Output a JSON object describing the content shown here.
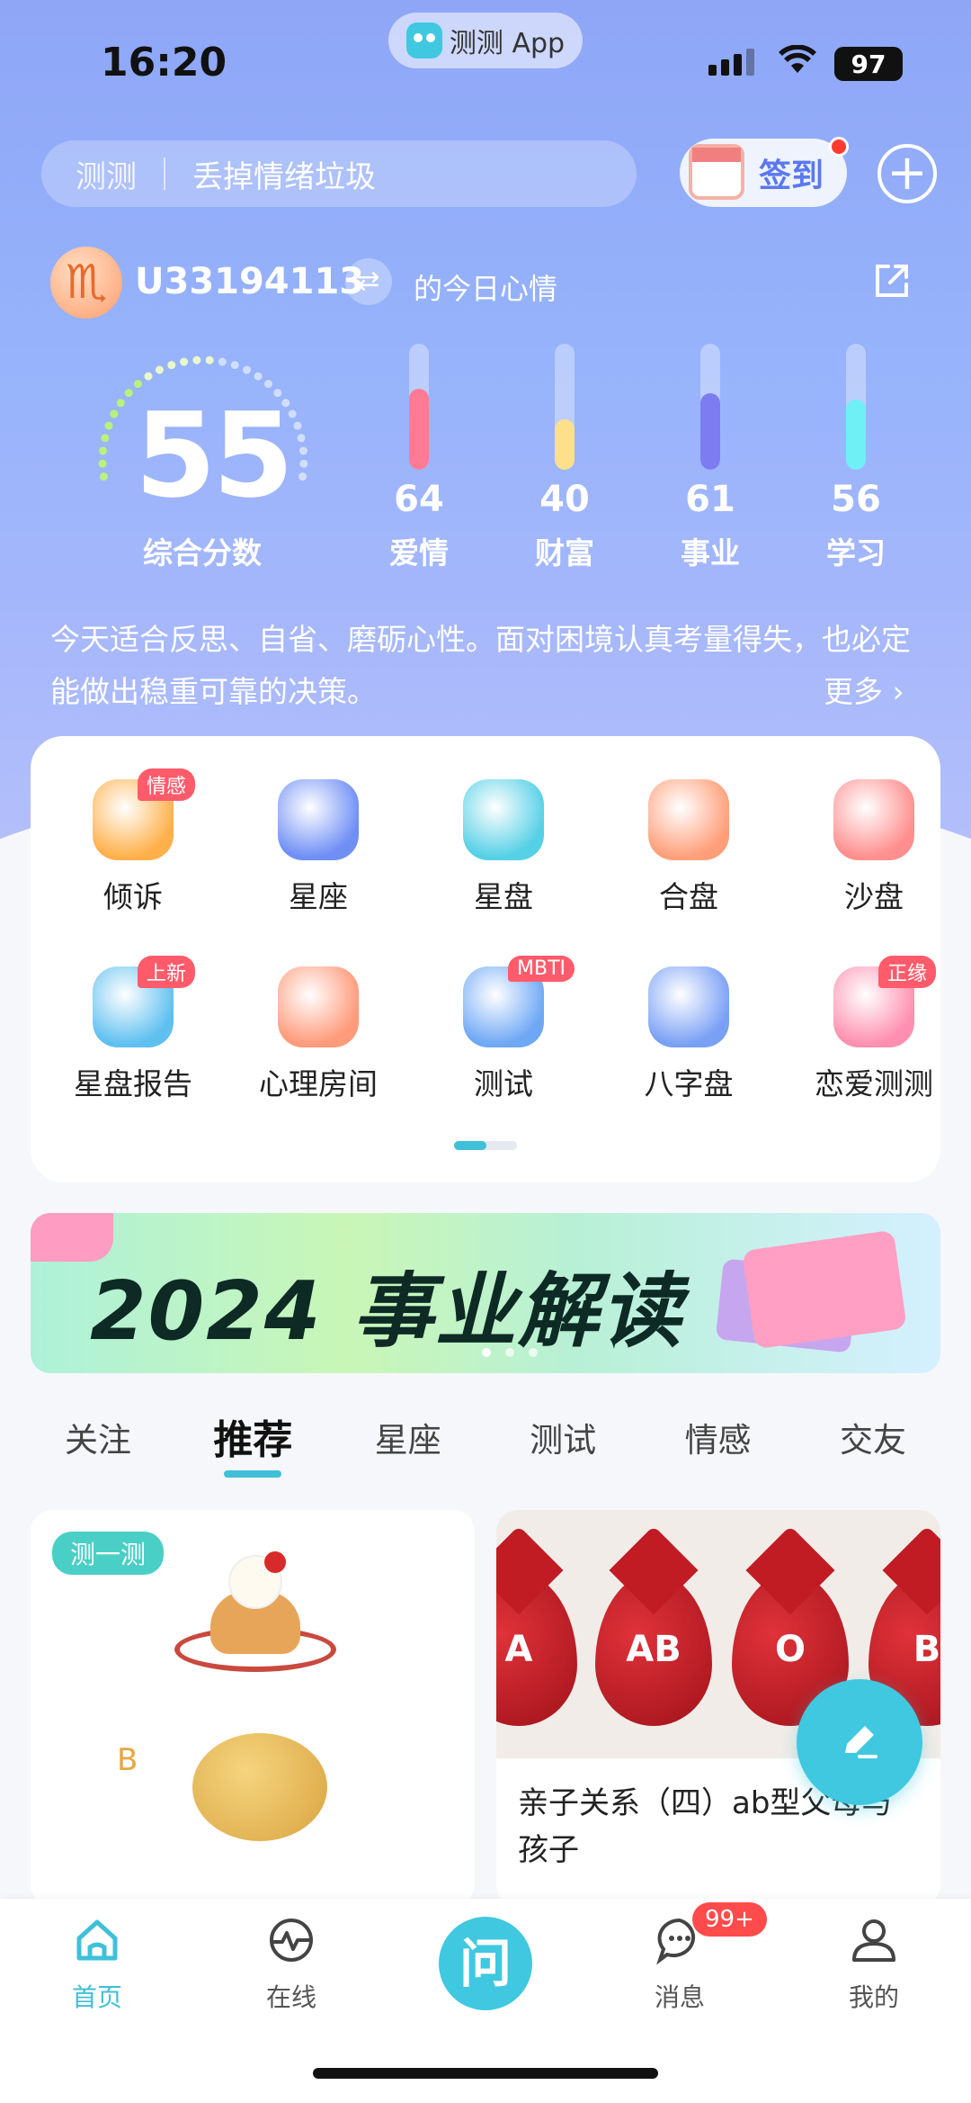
{
  "status": {
    "time": "16:20",
    "app_name": "测测 App",
    "battery": "97"
  },
  "search": {
    "brand": "测测",
    "placeholder": "丢掉情绪垃圾"
  },
  "signin": {
    "label": "签到"
  },
  "user": {
    "id": "U33194113",
    "today_label": "的今日心情",
    "sign_glyph": "♏"
  },
  "score": {
    "value": "55",
    "label": "综合分数",
    "value_numeric": 55
  },
  "metrics": [
    {
      "value": "64",
      "label": "爱情",
      "color": "#ff7a95",
      "level": 64
    },
    {
      "value": "40",
      "label": "财富",
      "color": "#ffe08a",
      "level": 40
    },
    {
      "value": "61",
      "label": "事业",
      "color": "#7d7cf1",
      "level": 61
    },
    {
      "value": "56",
      "label": "学习",
      "color": "#6ff0f5",
      "level": 56
    }
  ],
  "advice": {
    "text": "今天适合反思、自省、磨砺心性。面对困境认真考量得失，也必定能做出稳重可靠的决策。",
    "more": "更多"
  },
  "grid": [
    {
      "label": "倾诉",
      "badge": "情感",
      "icon": "chat-bubble-icon",
      "color": "#ffb04a"
    },
    {
      "label": "星座",
      "badge": "",
      "icon": "star-icon",
      "color": "#6f8ff5"
    },
    {
      "label": "星盘",
      "badge": "",
      "icon": "hexagram-icon",
      "color": "#56d0e6"
    },
    {
      "label": "合盘",
      "badge": "",
      "icon": "double-heart-icon",
      "color": "#ff9f7a"
    },
    {
      "label": "沙盘",
      "badge": "",
      "icon": "windmill-icon",
      "color": "#ff8e8e"
    },
    {
      "label": "星盘报告",
      "badge": "上新",
      "icon": "report-icon",
      "color": "#5fc0f0"
    },
    {
      "label": "心理房间",
      "badge": "",
      "icon": "heart-pulse-icon",
      "color": "#ff9a7a"
    },
    {
      "label": "测试",
      "badge": "MBTI",
      "icon": "test-icon",
      "color": "#6ea8f5"
    },
    {
      "label": "八字盘",
      "badge": "",
      "icon": "bagua-icon",
      "color": "#7aa0f5"
    },
    {
      "label": "恋爱测测",
      "badge": "正缘",
      "icon": "love-potion-icon",
      "color": "#ff8fb0"
    }
  ],
  "banner": {
    "text": "2024 事业解读"
  },
  "tabs": [
    {
      "label": "关注"
    },
    {
      "label": "推荐"
    },
    {
      "label": "星座"
    },
    {
      "label": "测试"
    },
    {
      "label": "情感"
    },
    {
      "label": "交友"
    }
  ],
  "feed": {
    "left": {
      "tag": "测一测",
      "option_b": "B"
    },
    "right": {
      "title": "亲子关系（四）ab型父母与孩子",
      "blood_types": [
        "A",
        "AB",
        "O",
        "B"
      ]
    }
  },
  "nav": [
    {
      "label": "首页",
      "icon": "home-icon"
    },
    {
      "label": "在线",
      "icon": "pulse-icon"
    },
    {
      "label": "问",
      "icon": "ask-icon"
    },
    {
      "label": "消息",
      "icon": "message-icon"
    },
    {
      "label": "我的",
      "icon": "profile-icon"
    }
  ],
  "messages_badge": "99+",
  "accent": "#3fc0d8"
}
